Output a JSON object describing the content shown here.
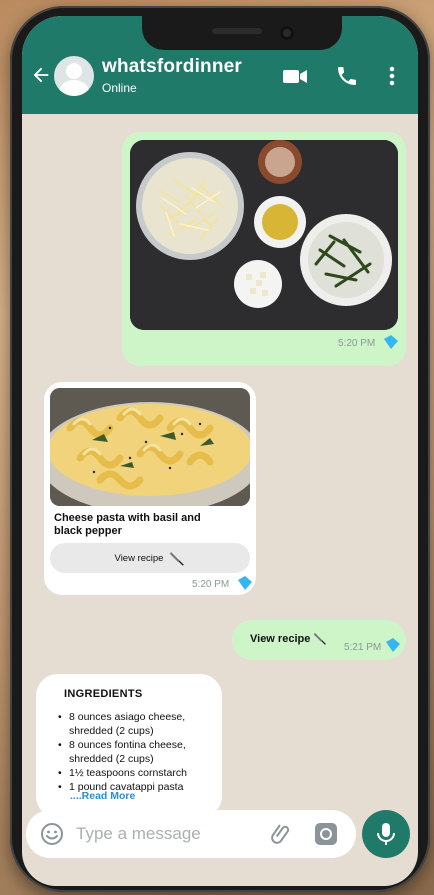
{
  "header": {
    "contact_name": "whatsfordinner",
    "status": "Online"
  },
  "messages": {
    "photo_time": "5:20 PM",
    "recipe_card": {
      "title": "Cheese pasta with basil and black pepper",
      "button_label": "View recipe",
      "time": "5:20 PM"
    },
    "reply": {
      "text": "View recipe",
      "time": "5:21 PM"
    },
    "ingredients": {
      "title": "INGREDIENTS",
      "items": [
        "8 ounces asiago cheese, shredded (2 cups)",
        "8 ounces fontina cheese, shredded (2 cups)",
        "1½ teaspoons cornstarch",
        "1 pound cavatappi pasta"
      ],
      "read_more": "....Read More"
    }
  },
  "composer": {
    "placeholder": "Type a message"
  },
  "icons": {
    "back": "arrow-left-icon",
    "video": "video-camera-icon",
    "call": "phone-icon",
    "menu": "more-vertical-icon",
    "emoji": "emoji-icon",
    "attach": "paperclip-icon",
    "camera": "camera-icon",
    "mic": "microphone-icon",
    "knife": "knife-icon",
    "read_receipt": "double-check-icon"
  },
  "colors": {
    "header": "#1f7a6a",
    "outgoing_bubble": "#cdf5c8",
    "incoming_bubble": "#ffffff",
    "chat_background": "#e6ddd2",
    "read_receipt": "#34b7f1",
    "link": "#2a8fcf"
  }
}
